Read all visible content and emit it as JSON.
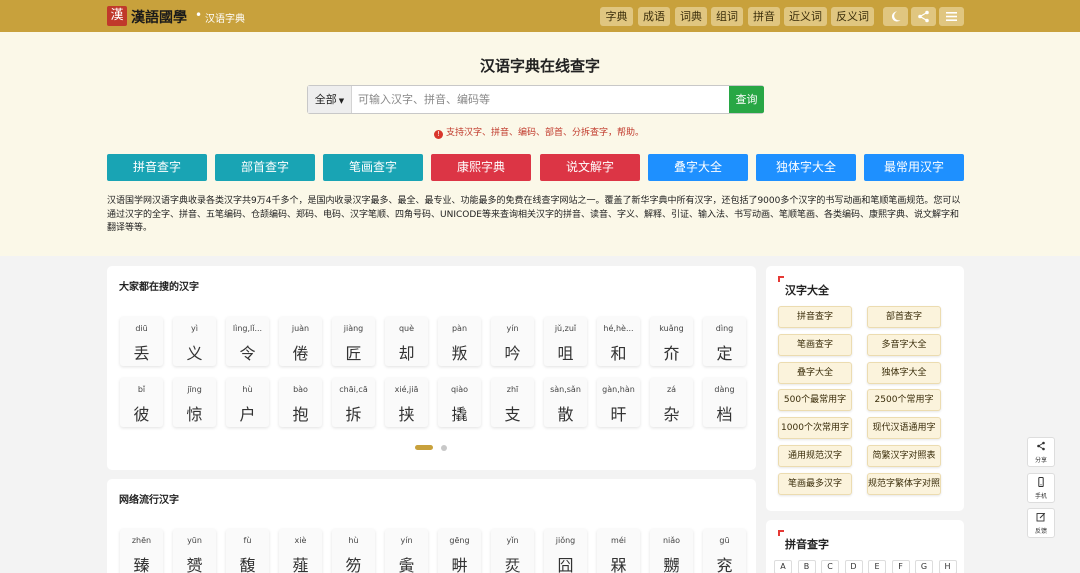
{
  "header": {
    "logo_glyph": "漢",
    "logo_text": "漢語國學",
    "separator": "•",
    "subtitle": "汉语字典",
    "nav": [
      "字典",
      "成语",
      "词典",
      "组词",
      "拼音",
      "近义词",
      "反义词"
    ],
    "icons": [
      "moon-icon",
      "share-icon",
      "menu-icon"
    ]
  },
  "hero": {
    "title": "汉语字典在线查字",
    "search": {
      "scope": "全部",
      "placeholder": "可输入汉字、拼音、编码等",
      "button": "查询"
    },
    "hint_icon": "!",
    "hint": "支持汉字、拼音、编码、部首、分拆查字，帮助。",
    "categories": [
      {
        "label": "拼音查字",
        "color": "#19a4b4"
      },
      {
        "label": "部首查字",
        "color": "#19a4b4"
      },
      {
        "label": "笔画查字",
        "color": "#19a4b4"
      },
      {
        "label": "康熙字典",
        "color": "#dc3545"
      },
      {
        "label": "说文解字",
        "color": "#dc3545"
      },
      {
        "label": "叠字大全",
        "color": "#1e90ff"
      },
      {
        "label": "独体字大全",
        "color": "#1e90ff"
      },
      {
        "label": "最常用汉字",
        "color": "#1e90ff"
      }
    ],
    "intro": "汉语国学网汉语字典收录各类汉字共9万4千多个，是国内收录汉字最多、最全、最专业、功能最多的免费在线查字网站之一。覆盖了新华字典中所有汉字，还包括了9000多个汉字的书写动画和笔顺笔画规范。您可以通过汉字的全字、拼音、五笔编码、仓颉编码、郑码、电码、汉字笔顺、四角号码、UNICODE等来查询相关汉字的拼音、读音、字义、解释、引证、输入法、书写动画、笔顺笔画、各类编码、康熙字典、说文解字和翻译等等。"
  },
  "popular": {
    "title": "大家都在搜的汉字",
    "rows": [
      [
        {
          "py": "diū",
          "ch": "丢"
        },
        {
          "py": "yì",
          "ch": "义"
        },
        {
          "py": "lìng,lǐ...",
          "ch": "令"
        },
        {
          "py": "juàn",
          "ch": "倦"
        },
        {
          "py": "jiàng",
          "ch": "匠"
        },
        {
          "py": "què",
          "ch": "却"
        },
        {
          "py": "pàn",
          "ch": "叛"
        },
        {
          "py": "yín",
          "ch": "吟"
        },
        {
          "py": "jǔ,zuǐ",
          "ch": "咀"
        },
        {
          "py": "hé,hè...",
          "ch": "和"
        },
        {
          "py": "kuǎng",
          "ch": "夼"
        },
        {
          "py": "dìng",
          "ch": "定"
        }
      ],
      [
        {
          "py": "bǐ",
          "ch": "彼"
        },
        {
          "py": "jīng",
          "ch": "惊"
        },
        {
          "py": "hù",
          "ch": "户"
        },
        {
          "py": "bào",
          "ch": "抱"
        },
        {
          "py": "chāi,cā",
          "ch": "拆"
        },
        {
          "py": "xié,jiā",
          "ch": "挟"
        },
        {
          "py": "qiào",
          "ch": "撬"
        },
        {
          "py": "zhī",
          "ch": "支"
        },
        {
          "py": "sàn,sǎn",
          "ch": "散"
        },
        {
          "py": "gàn,hàn",
          "ch": "旰"
        },
        {
          "py": "zá",
          "ch": "杂"
        },
        {
          "py": "dàng",
          "ch": "档"
        }
      ]
    ]
  },
  "trending": {
    "title": "网络流行汉字",
    "row": [
      {
        "py": "zhēn",
        "ch": "臻"
      },
      {
        "py": "yūn",
        "ch": "赟"
      },
      {
        "py": "fù",
        "ch": "馥"
      },
      {
        "py": "xiè",
        "ch": "薤"
      },
      {
        "py": "hù",
        "ch": "笏"
      },
      {
        "py": "yín",
        "ch": "夤"
      },
      {
        "py": "gēng",
        "ch": "畊"
      },
      {
        "py": "yǐn",
        "ch": "烎"
      },
      {
        "py": "jiǒng",
        "ch": "囧"
      },
      {
        "py": "méi",
        "ch": "槑"
      },
      {
        "py": "niǎo",
        "ch": "嬲"
      },
      {
        "py": "gū",
        "ch": "兖"
      }
    ]
  },
  "sidebar": {
    "title": "汉字大全",
    "tags": [
      "拼音查字",
      "部首查字",
      "笔画查字",
      "多音字大全",
      "叠字大全",
      "独体字大全",
      "500个最常用字",
      "2500个常用字",
      "1000个次常用字",
      "现代汉语通用字",
      "通用规范汉字",
      "简繁汉字对照表",
      "笔画最多汉字",
      "规范字繁体字对照"
    ],
    "pinyin_title": "拼音查字",
    "letters": [
      "A",
      "B",
      "C",
      "D",
      "E",
      "F",
      "G",
      "H"
    ]
  },
  "floating": [
    {
      "icon": "share-icon",
      "glyph": "⋖",
      "label": "分享"
    },
    {
      "icon": "phone-icon",
      "glyph": "▯",
      "label": "手机"
    },
    {
      "icon": "edit-icon",
      "glyph": "✎",
      "label": "反馈"
    }
  ],
  "colors": {
    "header": "#c8a13c",
    "hero_bg": "#fbf8e8",
    "teal": "#19a4b4",
    "red": "#dc3545",
    "blue": "#1e90ff",
    "green": "#28a745"
  }
}
